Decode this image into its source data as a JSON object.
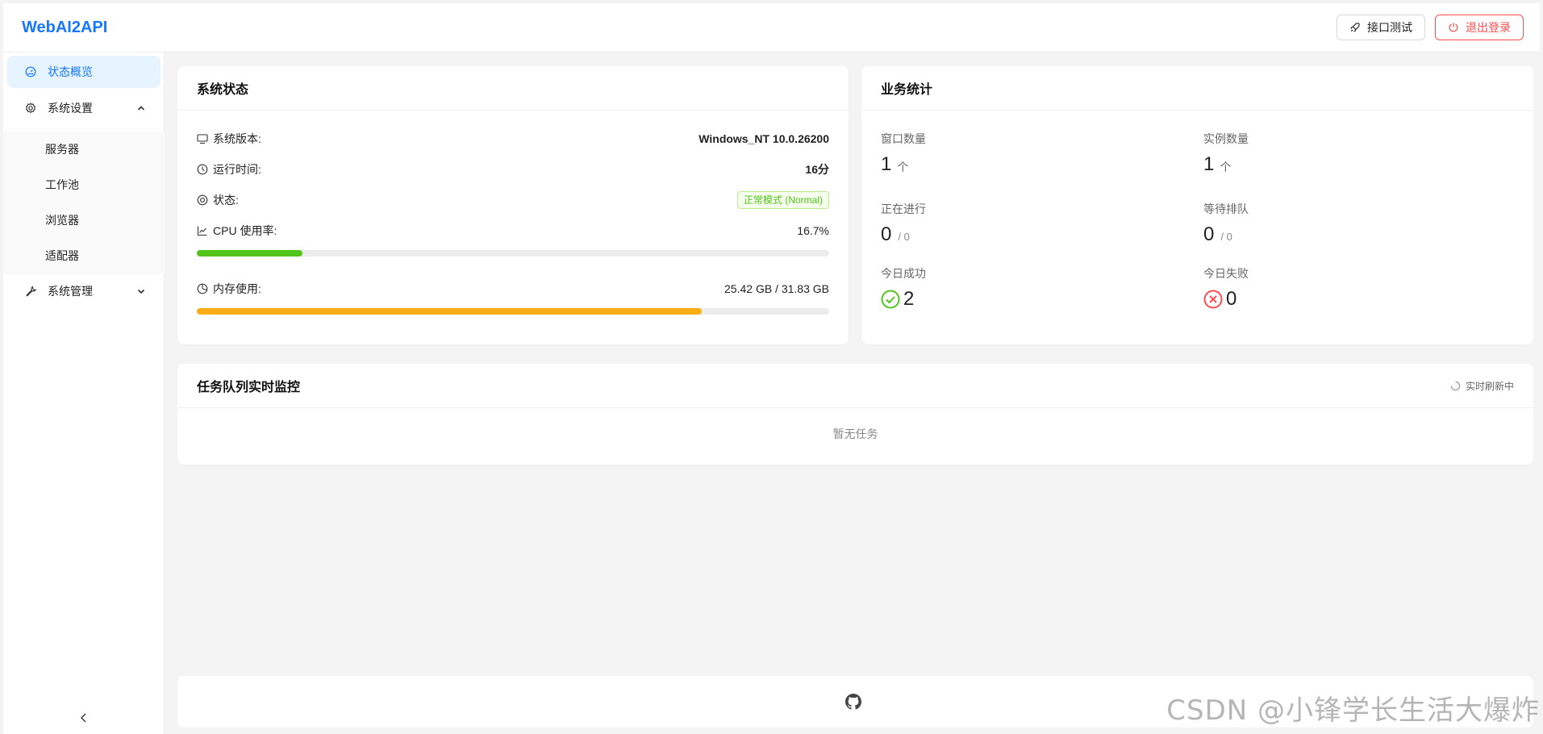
{
  "app": {
    "logo": "WebAI2API"
  },
  "header": {
    "api_test_label": "接口测试",
    "logout_label": "退出登录",
    "danger_color": "#ff4d4f"
  },
  "sidebar": {
    "items": [
      {
        "label": "状态概览",
        "icon": "dashboard-icon",
        "active": true
      },
      {
        "label": "系统设置",
        "icon": "gear-icon",
        "expanded": true,
        "children": [
          {
            "label": "服务器"
          },
          {
            "label": "工作池"
          },
          {
            "label": "浏览器"
          },
          {
            "label": "适配器"
          }
        ]
      },
      {
        "label": "系统管理",
        "icon": "wrench-icon",
        "expanded": false
      }
    ],
    "accent_color": "#1677ff"
  },
  "system_status": {
    "title": "系统状态",
    "version_label": "系统版本:",
    "version_value": "Windows_NT 10.0.26200",
    "uptime_label": "运行时间:",
    "uptime_value": "16分",
    "status_label": "状态:",
    "status_value": "正常模式 (Normal)",
    "cpu_label": "CPU 使用率:",
    "cpu_value": "16.7%",
    "cpu_percent": 16.7,
    "cpu_color": "#52c41a",
    "memory_label": "内存使用:",
    "memory_value": "25.42 GB / 31.83 GB",
    "memory_percent": 79.9,
    "memory_color": "#faad14"
  },
  "business_stats": {
    "title": "业务统计",
    "windows_label": "窗口数量",
    "windows_value": "1",
    "windows_unit": "个",
    "instances_label": "实例数量",
    "instances_value": "1",
    "instances_unit": "个",
    "running_label": "正在进行",
    "running_value": "0",
    "running_total": "/ 0",
    "queued_label": "等待排队",
    "queued_value": "0",
    "queued_total": "/ 0",
    "success_label": "今日成功",
    "success_value": "2",
    "fail_label": "今日失败",
    "fail_value": "0"
  },
  "task_queue": {
    "title": "任务队列实时监控",
    "refresh_label": "实时刷新中",
    "empty_text": "暂无任务"
  },
  "footer": {
    "icon": "github-icon"
  },
  "watermark": "CSDN @小锋学长生活大爆炸"
}
